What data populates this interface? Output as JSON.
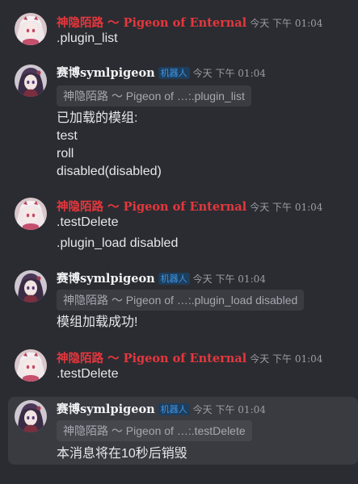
{
  "messages": [
    {
      "author": "神隐陌路 ～ Pigeon of Enternal",
      "time": "今天 下午 01:04",
      "lines": [
        ".plugin_list"
      ]
    },
    {
      "author": "赛博symlpigeon",
      "badge": "机器人",
      "time": "今天 下午 01:04",
      "quote": "神隐陌路 ～ Pigeon of …:.plugin_list",
      "lines": [
        "已加载的模组:",
        "test",
        "roll",
        "disabled(disabled)"
      ]
    },
    {
      "author": "神隐陌路 ～ Pigeon of Enternal",
      "time": "今天 下午 01:04",
      "lines": [
        ".testDelete",
        ".plugin_load disabled"
      ]
    },
    {
      "author": "赛博symlpigeon",
      "badge": "机器人",
      "time": "今天 下午 01:04",
      "quote": "神隐陌路 ～ Pigeon of …:.plugin_load disabled",
      "lines": [
        "模组加载成功!"
      ]
    },
    {
      "author": "神隐陌路 ～ Pigeon of Enternal",
      "time": "今天 下午 01:04",
      "lines": [
        ".testDelete"
      ]
    },
    {
      "author": "赛博symlpigeon",
      "badge": "机器人",
      "time": "今天 下午 01:04",
      "quote": "神隐陌路 ～ Pigeon of …:.testDelete",
      "lines": [
        "本消息将在10秒后销毁"
      ]
    }
  ],
  "colors": {
    "background": "#2b2c31",
    "human_name": "#e5373d",
    "bot_name": "#f2f3f5",
    "bot_badge": "#3e96e8",
    "highlight_row": "#393b41"
  },
  "icons": {
    "human_avatar": "anime-girl-pink-avatar",
    "bot_avatar": "anime-girl-dark-avatar"
  }
}
